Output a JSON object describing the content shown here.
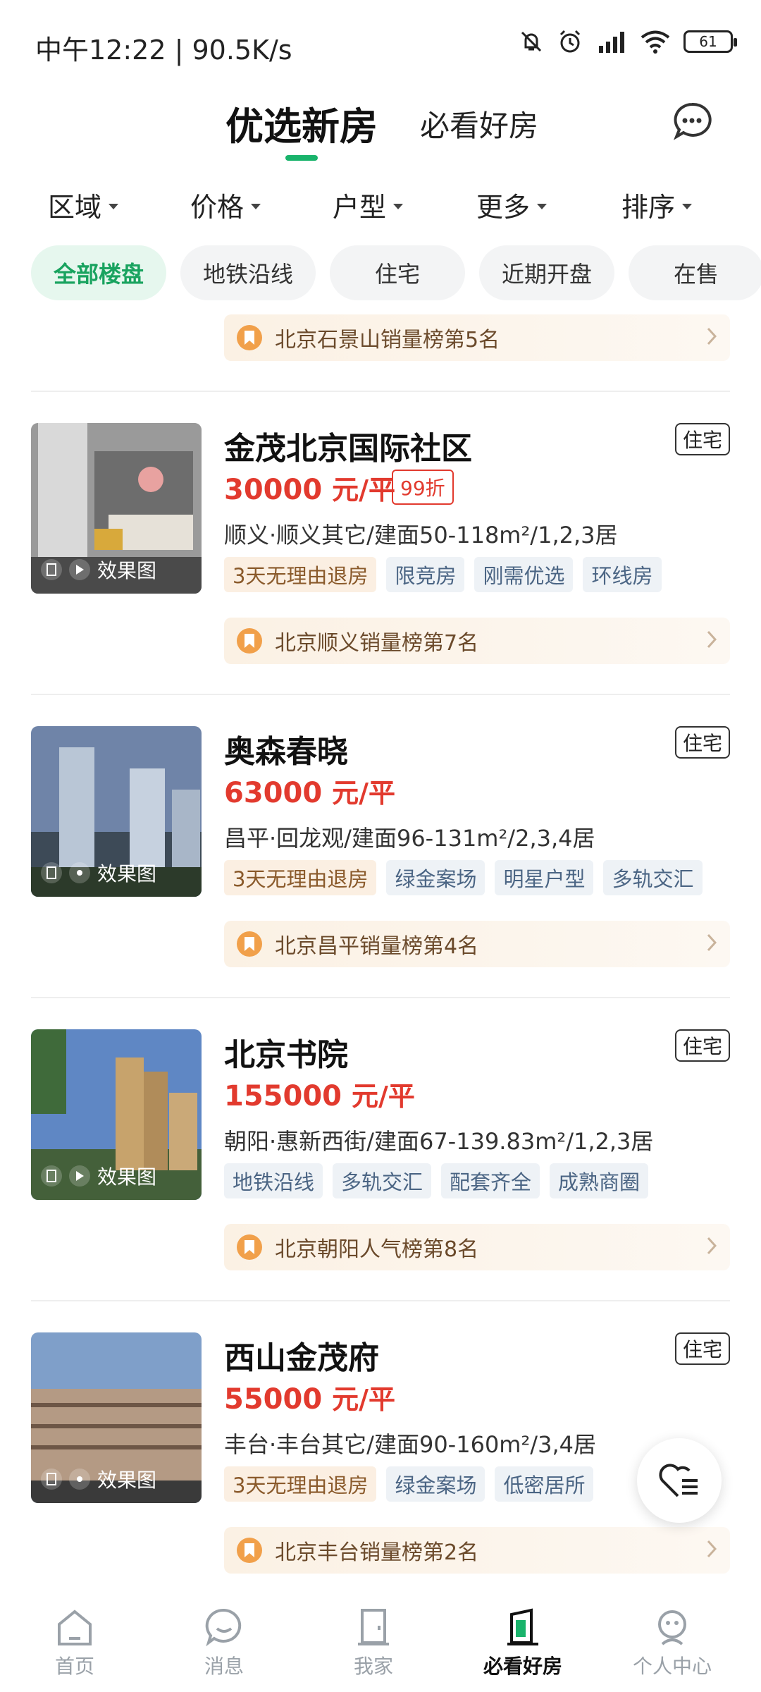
{
  "status": {
    "time": "中午12:22 | 90.5K/s",
    "battery": "61"
  },
  "header": {
    "tabs": [
      {
        "label": "优选新房"
      },
      {
        "label": "必看好房"
      }
    ]
  },
  "filters": [
    {
      "label": "区域"
    },
    {
      "label": "价格"
    },
    {
      "label": "户型"
    },
    {
      "label": "更多"
    },
    {
      "label": "排序"
    }
  ],
  "chips": [
    {
      "label": "全部楼盘"
    },
    {
      "label": "地铁沿线"
    },
    {
      "label": "住宅"
    },
    {
      "label": "近期开盘"
    },
    {
      "label": "在售"
    }
  ],
  "top_rank": "北京石景山销量榜第5名",
  "listings": [
    {
      "thumb_label": "效果图",
      "title": "金茂北京国际社区",
      "type": "住宅",
      "price": "30000",
      "unit": "元/平",
      "discount": "99折",
      "desc": "顺义·顺义其它/建面50-118m²/1,2,3居",
      "tags": [
        "3天无理由退房",
        "限竞房",
        "刚需优选",
        "环线房"
      ],
      "rank": "北京顺义销量榜第7名"
    },
    {
      "thumb_label": "效果图",
      "title": "奥森春晓",
      "type": "住宅",
      "price": "63000",
      "unit": "元/平",
      "desc": "昌平·回龙观/建面96-131m²/2,3,4居",
      "tags": [
        "3天无理由退房",
        "绿金案场",
        "明星户型",
        "多轨交汇"
      ],
      "rank": "北京昌平销量榜第4名"
    },
    {
      "thumb_label": "效果图",
      "title": "北京书院",
      "type": "住宅",
      "price": "155000",
      "unit": "元/平",
      "desc": "朝阳·惠新西街/建面67-139.83m²/1,2,3居",
      "tags": [
        "地铁沿线",
        "多轨交汇",
        "配套齐全",
        "成熟商圈"
      ],
      "rank": "北京朝阳人气榜第8名"
    },
    {
      "thumb_label": "效果图",
      "title": "西山金茂府",
      "type": "住宅",
      "price": "55000",
      "unit": "元/平",
      "desc": "丰台·丰台其它/建面90-160m²/3,4居",
      "tags": [
        "3天无理由退房",
        "绿金案场",
        "低密居所"
      ],
      "rank": "北京丰台销量榜第2名"
    }
  ],
  "bottom_nav": [
    {
      "label": "首页"
    },
    {
      "label": "消息"
    },
    {
      "label": "我家"
    },
    {
      "label": "必看好房"
    },
    {
      "label": "个人中心"
    }
  ],
  "colors": {
    "accent": "#19b36b",
    "price": "#e23a2e",
    "rank_text": "#6b4a2b"
  }
}
